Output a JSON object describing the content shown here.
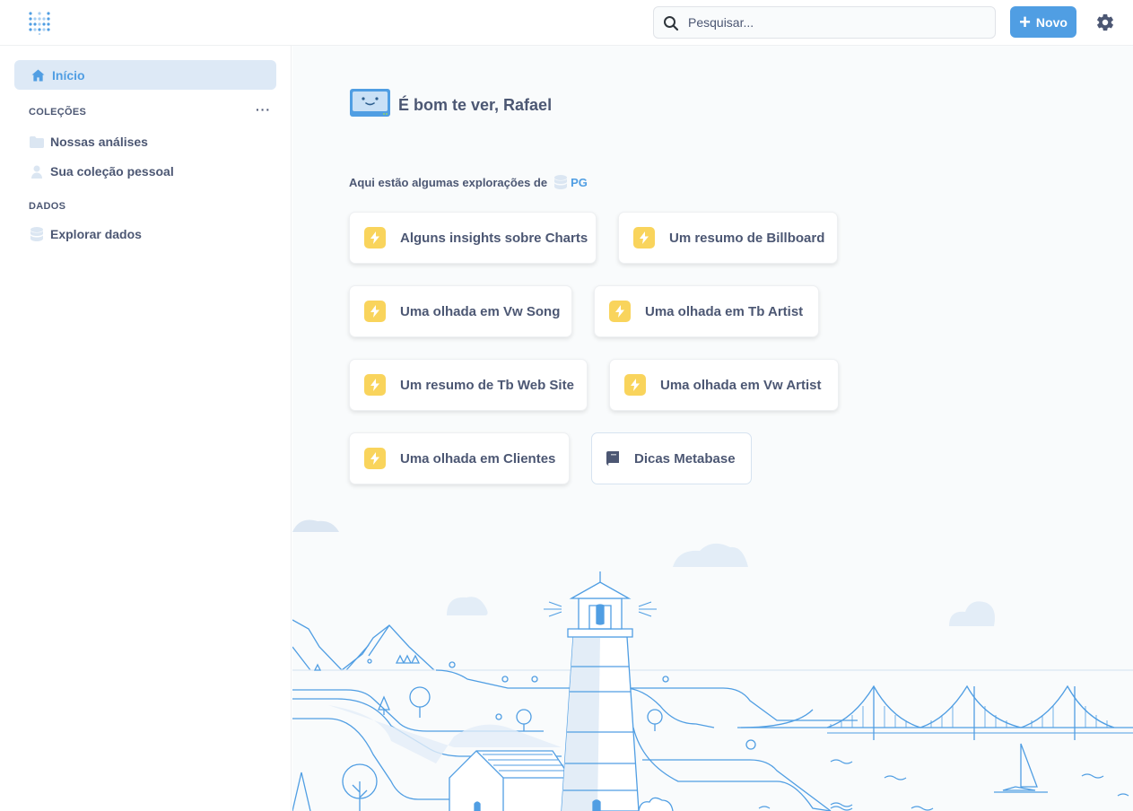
{
  "header": {
    "search_placeholder": "Pesquisar...",
    "new_button_label": "Novo"
  },
  "sidebar": {
    "home_label": "Início",
    "collections_title": "COLEÇÕES",
    "collections_more": "···",
    "collections": [
      {
        "label": "Nossas análises",
        "icon": "folder-icon"
      },
      {
        "label": "Sua coleção pessoal",
        "icon": "person-icon"
      }
    ],
    "data_title": "DADOS",
    "data_items": [
      {
        "label": "Explorar dados",
        "icon": "database-icon"
      }
    ]
  },
  "main": {
    "greeting": "É bom te ver, Rafael",
    "explore_prefix": "Aqui estão algumas explorações de",
    "database_name": "PG",
    "cards": [
      {
        "prefix": "Alguns insights sobre",
        "name": "Charts"
      },
      {
        "prefix": "Um resumo de",
        "name": "Billboard"
      },
      {
        "prefix": "Uma olhada em",
        "name": "Vw Song"
      },
      {
        "prefix": "Uma olhada em",
        "name": "Tb Artist"
      },
      {
        "prefix": "Um resumo de",
        "name": "Tb Web Site"
      },
      {
        "prefix": "Uma olhada em",
        "name": "Vw Artist"
      },
      {
        "prefix": "Uma olhada em",
        "name": "Clientes"
      }
    ],
    "tips_label": "Dicas Metabase"
  },
  "colors": {
    "brand": "#509ee3",
    "text": "#4c5773",
    "bolt": "#f9d45c",
    "active_bg": "#dde9f6",
    "illustration": "#509ee3"
  }
}
